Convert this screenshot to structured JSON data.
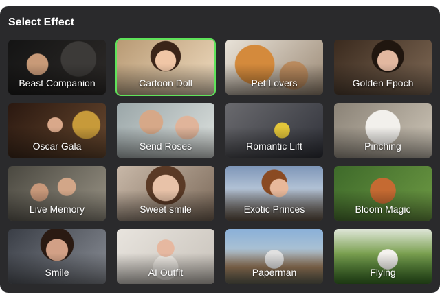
{
  "title": "Select Effect",
  "selected_index": 1,
  "accent_color": "#5fe25a",
  "effects": [
    {
      "label": "Beast Companion"
    },
    {
      "label": "Cartoon Doll"
    },
    {
      "label": "Pet Lovers"
    },
    {
      "label": "Golden Epoch"
    },
    {
      "label": "Oscar Gala"
    },
    {
      "label": "Send Roses"
    },
    {
      "label": "Romantic Lift"
    },
    {
      "label": "Pinching"
    },
    {
      "label": "Live Memory"
    },
    {
      "label": "Sweet smile"
    },
    {
      "label": "Exotic Princes"
    },
    {
      "label": "Bloom Magic"
    },
    {
      "label": "Smile"
    },
    {
      "label": "AI Outfit"
    },
    {
      "label": "Paperman"
    },
    {
      "label": "Flying"
    }
  ]
}
